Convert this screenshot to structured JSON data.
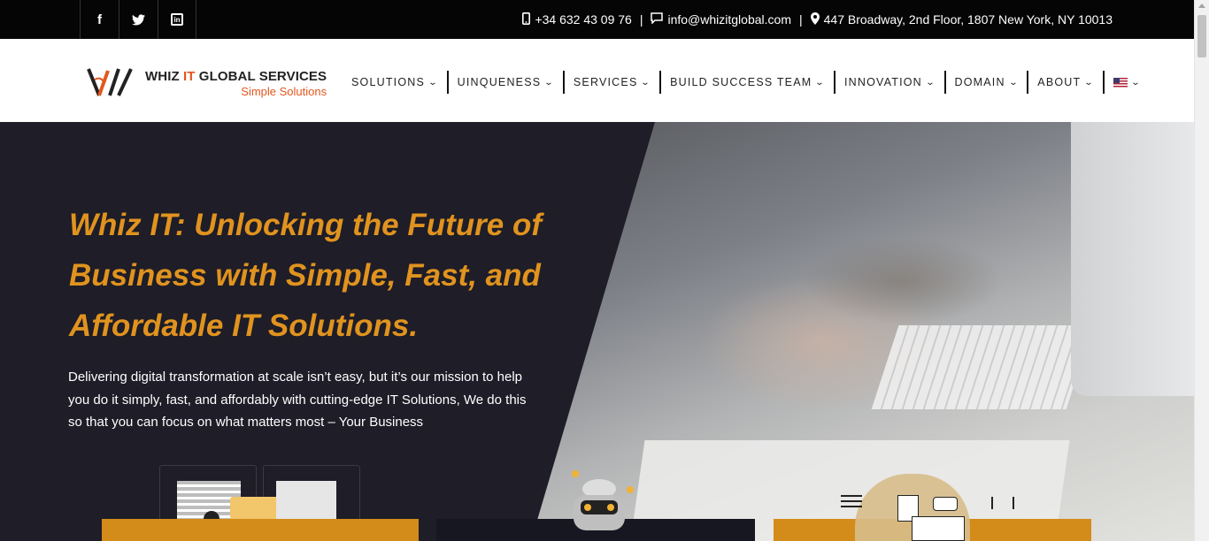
{
  "topbar": {
    "social": [
      {
        "name": "facebook-icon",
        "glyph": "f"
      },
      {
        "name": "twitter-icon",
        "glyph": "🐦"
      },
      {
        "name": "linkedin-icon",
        "glyph": "in"
      }
    ],
    "phone": "+34 632 43 09 76",
    "email": "info@whizitglobal.com",
    "address": "447 Broadway, 2nd Floor, 1807 New York, NY 10013",
    "separator": "|"
  },
  "header": {
    "logo": {
      "line1_a": "WHIZ ",
      "line1_b": "IT",
      "line1_c": " GLOBAL SERVICES",
      "tagline": "Simple Solutions"
    },
    "nav": [
      {
        "label": "SOLUTIONS"
      },
      {
        "label": "UINQUENESS"
      },
      {
        "label": "SERVICES"
      },
      {
        "label": "BUILD SUCCESS TEAM"
      },
      {
        "label": "INNOVATION"
      },
      {
        "label": "DOMAIN"
      },
      {
        "label": "ABOUT"
      }
    ],
    "chevron": "⌄"
  },
  "hero": {
    "headline": "Whiz IT: Unlocking the Future of Business with Simple, Fast, and Affordable IT Solutions.",
    "body": "Delivering digital transformation at scale isn’t easy, but it’s our mission to help you do it simply, fast, and affordably with cutting-edge IT Solutions, We do this so that you can focus on what matters most – Your Business"
  },
  "colors": {
    "accent": "#e0931e",
    "brand_orange": "#e2571e",
    "hero_bg": "#1e1d28",
    "topbar_bg": "#050505"
  }
}
